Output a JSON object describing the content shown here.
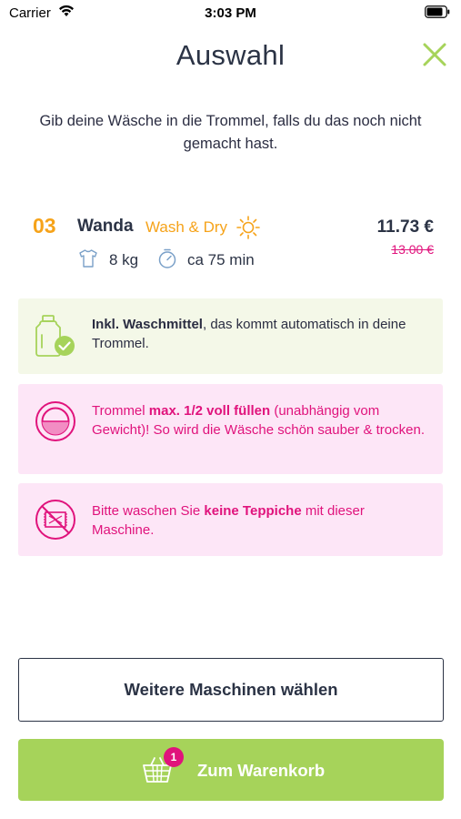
{
  "status_bar": {
    "carrier": "Carrier",
    "time": "3:03 PM"
  },
  "header": {
    "title": "Auswahl"
  },
  "subtitle": "Gib deine Wäsche in die Trommel, falls du das noch nicht gemacht hast.",
  "machine": {
    "number": "03",
    "name": "Wanda",
    "program": "Wash & Dry",
    "price": "11.73 €",
    "old_price": "13.00 €",
    "capacity": "8 kg",
    "duration": "ca 75 min"
  },
  "info": {
    "detergent": {
      "bold": "Inkl. Waschmittel",
      "rest": ", das kommt automatisch in deine Trommel."
    },
    "fill": {
      "pre": "Trommel ",
      "bold": "max. 1/2 voll füllen",
      "rest": " (unabhängig vom Gewicht)! So wird die Wäsche schön sauber & trocken."
    },
    "carpet": {
      "pre": "Bitte waschen Sie ",
      "bold": "keine Teppiche",
      "rest": " mit dieser Maschine."
    }
  },
  "buttons": {
    "more_machines": "Weitere Maschinen wählen",
    "to_cart": "Zum Warenkorb",
    "cart_count": "1"
  },
  "colors": {
    "accent_green": "#a6d35a",
    "accent_orange": "#f6a31a",
    "accent_pink": "#e0137c",
    "text_dark": "#2b3345"
  },
  "icons": [
    "wifi-icon",
    "battery-icon",
    "close-icon",
    "sun-icon",
    "shirt-icon",
    "timer-icon",
    "detergent-icon",
    "drum-icon",
    "no-carpet-icon",
    "basket-icon"
  ]
}
